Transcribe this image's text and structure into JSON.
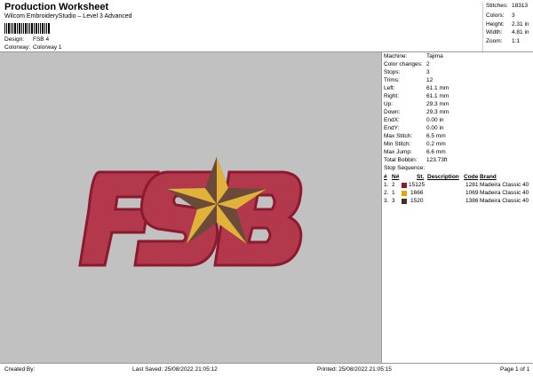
{
  "header": {
    "title": "Production Worksheet",
    "subtitle": "Wilcom EmbroideryStudio – Level 3 Advanced",
    "design_label": "Design:",
    "design_value": "FSB 4",
    "colorway_label": "Colorway:",
    "colorway_value": "Colorway 1"
  },
  "summary": {
    "rows": [
      {
        "label": "Stitches:",
        "value": "18313"
      },
      {
        "label": "Colors:",
        "value": "3"
      },
      {
        "label": "Height:",
        "value": "2.31 in"
      },
      {
        "label": "Width:",
        "value": "4.81 in"
      },
      {
        "label": "Zoom:",
        "value": "1:1"
      }
    ]
  },
  "details": {
    "rows": [
      {
        "label": "Machine:",
        "value": "Tajima"
      },
      {
        "label": "Color changes:",
        "value": "2"
      },
      {
        "label": "Stops:",
        "value": "3"
      },
      {
        "label": "Trims:",
        "value": "12"
      },
      {
        "label": "Left:",
        "value": "61.1 mm"
      },
      {
        "label": "Right:",
        "value": "61.1 mm"
      },
      {
        "label": "Up:",
        "value": "29.3 mm"
      },
      {
        "label": "Down:",
        "value": "29.3 mm"
      },
      {
        "label": "EndX:",
        "value": "0.00 in"
      },
      {
        "label": "EndY:",
        "value": "0.00 in"
      },
      {
        "label": "Max Stitch:",
        "value": "6.5 mm"
      },
      {
        "label": "Min Stitch:",
        "value": "0.2 mm"
      },
      {
        "label": "Max Jump:",
        "value": "6.6 mm"
      },
      {
        "label": "Total Bobbin:",
        "value": "123.73ft"
      }
    ],
    "stop_sequence_label": "Stop Sequence:"
  },
  "stop_table": {
    "headers": {
      "hash": "#",
      "n": "N#",
      "st": "St.",
      "description": "Description",
      "code": "Code",
      "brand": "Brand"
    },
    "rows": [
      {
        "hash": "1.",
        "n": "2",
        "color": "#8b1a2e",
        "st": "15125",
        "description": "",
        "code": "1281",
        "brand": "Madeira Classic 40"
      },
      {
        "hash": "2.",
        "n": "1",
        "color": "#e0a800",
        "st": "1666",
        "description": "",
        "code": "1069",
        "brand": "Madeira Classic 40"
      },
      {
        "hash": "3.",
        "n": "3",
        "color": "#4a2c22",
        "st": "1520",
        "description": "",
        "code": "1386",
        "brand": "Madeira Classic 40"
      }
    ]
  },
  "design_art": {
    "letters": "FSB",
    "fill_color": "#b83a4e",
    "outline_color": "#8b1a2e",
    "star_gold": "#e0b23a",
    "star_brown": "#6b4a3a"
  },
  "footer": {
    "created_by": "Created By:",
    "last_saved": "Last Saved: 25/08/2022 21:05:12",
    "printed": "Printed: 25/08/2022 21:05:15",
    "page": "Page 1 of 1"
  }
}
